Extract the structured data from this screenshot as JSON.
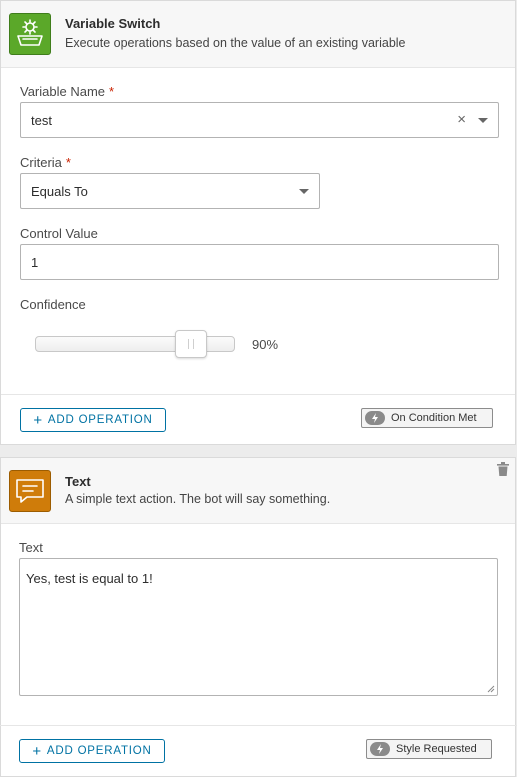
{
  "variable_switch": {
    "title": "Variable Switch",
    "subtitle": "Execute operations based on the value of an existing variable",
    "icon": "sink-icon",
    "fields": {
      "variable_name": {
        "label": "Variable Name",
        "required_mark": "*",
        "value": "test",
        "clear": "×"
      },
      "criteria": {
        "label": "Criteria",
        "required_mark": "*",
        "value": "Equals To"
      },
      "control_value": {
        "label": "Control Value",
        "value": "1"
      },
      "confidence": {
        "label": "Confidence",
        "value_text": "90%",
        "value_fraction": 0.8
      }
    },
    "add_operation": {
      "plus": "+",
      "label": "ADD OPERATION"
    },
    "badge": {
      "icon": "lightning-icon",
      "label": "On Condition Met"
    }
  },
  "text_action": {
    "title": "Text",
    "subtitle": "A simple text action. The bot will say something.",
    "icon": "chat-bubble-icon",
    "delete_icon": "trash-icon",
    "field": {
      "label": "Text",
      "value": "Yes, test is equal to 1!"
    },
    "add_operation": {
      "plus": "+",
      "label": "ADD OPERATION"
    },
    "badge": {
      "icon": "lightning-icon",
      "label": "Style Requested"
    }
  },
  "colors": {
    "green": "#5ba829",
    "orange": "#cf7c0a",
    "link_blue": "#0072a3",
    "required_red": "#c92100"
  }
}
